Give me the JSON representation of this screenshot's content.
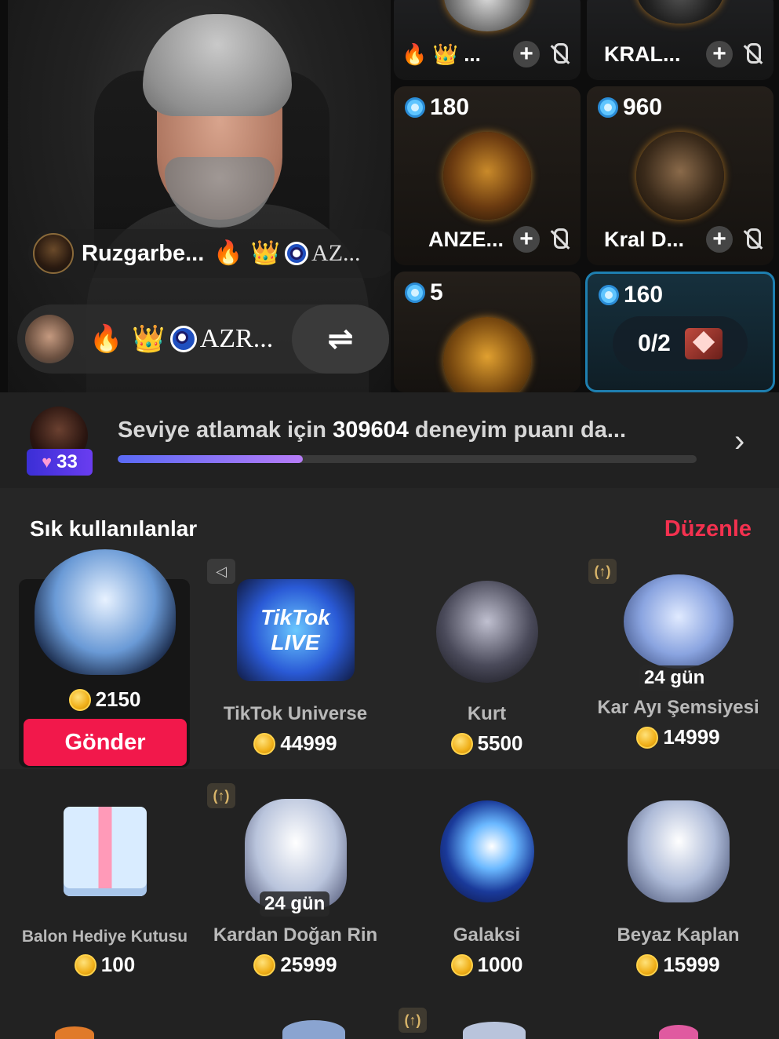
{
  "host": {
    "name": "Ruzgarbe...",
    "badges": [
      "🔥",
      "👑"
    ],
    "tag_text": "AZ..."
  },
  "guest": {
    "badges": [
      "🔥",
      "👑"
    ],
    "tag_text": "AZR...",
    "swap_icon": "⇌"
  },
  "seats": [
    {
      "name": "",
      "score": "",
      "badges": "🔥 👑 ..."
    },
    {
      "name": "KRAL...",
      "score": ""
    },
    {
      "name": "ANZE...",
      "score": "180"
    },
    {
      "name": "Kral D...",
      "score": "960"
    },
    {
      "name": "",
      "score": "5"
    },
    {
      "name": "",
      "score": "160",
      "counter": "0/2"
    }
  ],
  "seat_add": "+",
  "level": {
    "badge": "33",
    "text_prefix": "Seviye atlamak için ",
    "points": "309604",
    "text_suffix": " deneyim puanı da...",
    "progress_percent": 32
  },
  "gifts_section": {
    "title": "Sık kullanılanlar",
    "edit_label": "Düzenle",
    "send_label": "Gönder"
  },
  "gifts": [
    {
      "name": "",
      "price": "2150"
    },
    {
      "name": "TikTok Universe",
      "price": "44999",
      "art_text": "TikTok LIVE"
    },
    {
      "name": "Kurt",
      "price": "5500"
    },
    {
      "name": "Kar Ayı Şemsiyesi",
      "price": "14999",
      "days": "24 gün"
    },
    {
      "name": "Balon Hediye Kutusu",
      "price": "100"
    },
    {
      "name": "Kardan Doğan Rin",
      "price": "25999",
      "days": "24 gün"
    },
    {
      "name": "Galaksi",
      "price": "1000"
    },
    {
      "name": "Beyaz Kaplan",
      "price": "15999"
    }
  ],
  "colors": {
    "accent": "#f2184b",
    "edit": "#f3314f",
    "progress": "#7a6af6"
  }
}
